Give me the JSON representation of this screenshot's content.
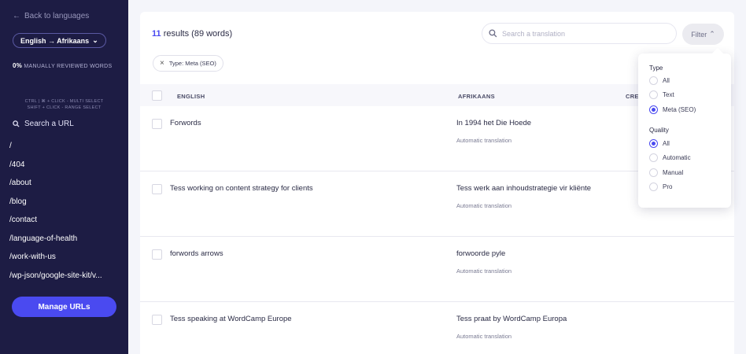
{
  "sidebar": {
    "back_label": "Back to languages",
    "language_pair": "English → Afrikaans",
    "reviewed_percent": "0%",
    "reviewed_label": "MANUALLY REVIEWED WORDS",
    "hint_line1": "CTRL | ⌘ + CLICK - MULTI SELECT",
    "hint_line2": "SHIFT + CLICK - RANGE SELECT",
    "search_label": "Search a URL",
    "urls": [
      "/",
      "/404",
      "/about",
      "/blog",
      "/contact",
      "/language-of-health",
      "/work-with-us",
      "/wp-json/google-site-kit/v..."
    ],
    "manage_button": "Manage URLs"
  },
  "toolbar": {
    "result_count": "11",
    "result_text": "results (89 words)",
    "search_placeholder": "Search a translation",
    "filter_label": "Filter",
    "active_chip": "Type: Meta (SEO)"
  },
  "table": {
    "headers": [
      "ENGLISH",
      "AFRIKAANS",
      "CRE"
    ],
    "rows": [
      {
        "source": "Forwords",
        "target": "In 1994 het Die Hoede",
        "kind": "Automatic translation"
      },
      {
        "source": "Tess working on content strategy for clients",
        "target": "Tess werk aan inhoudstrategie vir kliënte",
        "kind": "Automatic translation"
      },
      {
        "source": "forwords arrows",
        "target": "forwoorde pyle",
        "kind": "Automatic translation"
      },
      {
        "source": "Tess speaking at WordCamp Europe",
        "target": "Tess praat by WordCamp Europa",
        "kind": "Automatic translation"
      }
    ]
  },
  "filter_dropdown": {
    "type_heading": "Type",
    "type_options": [
      "All",
      "Text",
      "Meta (SEO)"
    ],
    "type_selected": "Meta (SEO)",
    "quality_heading": "Quality",
    "quality_options": [
      "All",
      "Automatic",
      "Manual",
      "Pro"
    ],
    "quality_selected": "All"
  },
  "colors": {
    "sidebar_bg": "#1d1c44",
    "accent": "#4a4af0"
  }
}
